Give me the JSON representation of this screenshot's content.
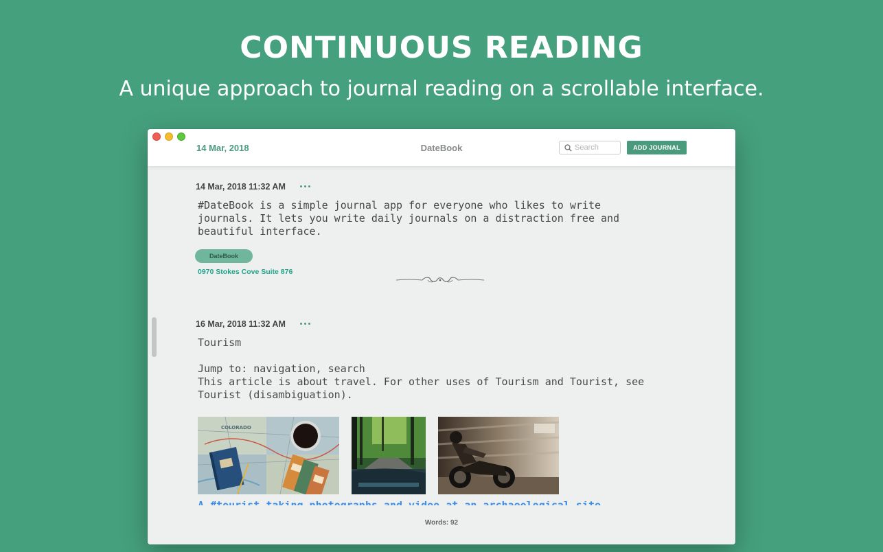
{
  "hero": {
    "title": "CONTINUOUS READING",
    "subtitle": "A unique approach to journal reading on a scrollable interface."
  },
  "window": {
    "current_date": "14 Mar, 2018",
    "app_title": "DateBook",
    "search": {
      "placeholder": "Search",
      "value": ""
    },
    "add_button_label": "ADD JOURNAL"
  },
  "entries": [
    {
      "timestamp": "14 Mar, 2018 11:32 AM",
      "text": "#DateBook is a simple journal app for everyone who likes to write\njournals. It lets you write daily journals on a distraction free and\nbeautiful interface.",
      "tag": "DateBook",
      "location": "0970 Stokes Cove Suite 876"
    },
    {
      "timestamp": "16 Mar, 2018 11:32 AM",
      "text": "Tourism\n\nJump to: navigation, search\nThis article is about travel. For other uses of Tourism and Tourist, see\nTourist (disambiguation).",
      "images": [
        "map-coffee-photo",
        "forest-road-photo",
        "motorcycle-rider-photo"
      ],
      "image_text": "COLORADO",
      "caption": "A #tourist taking photographs and video at an archaeological site"
    }
  ],
  "footer": {
    "word_count": "Words: 92"
  },
  "colors": {
    "background": "#45a07d",
    "accent": "#4a9a7e",
    "link": "#3d8de8",
    "location": "#20a48b"
  }
}
